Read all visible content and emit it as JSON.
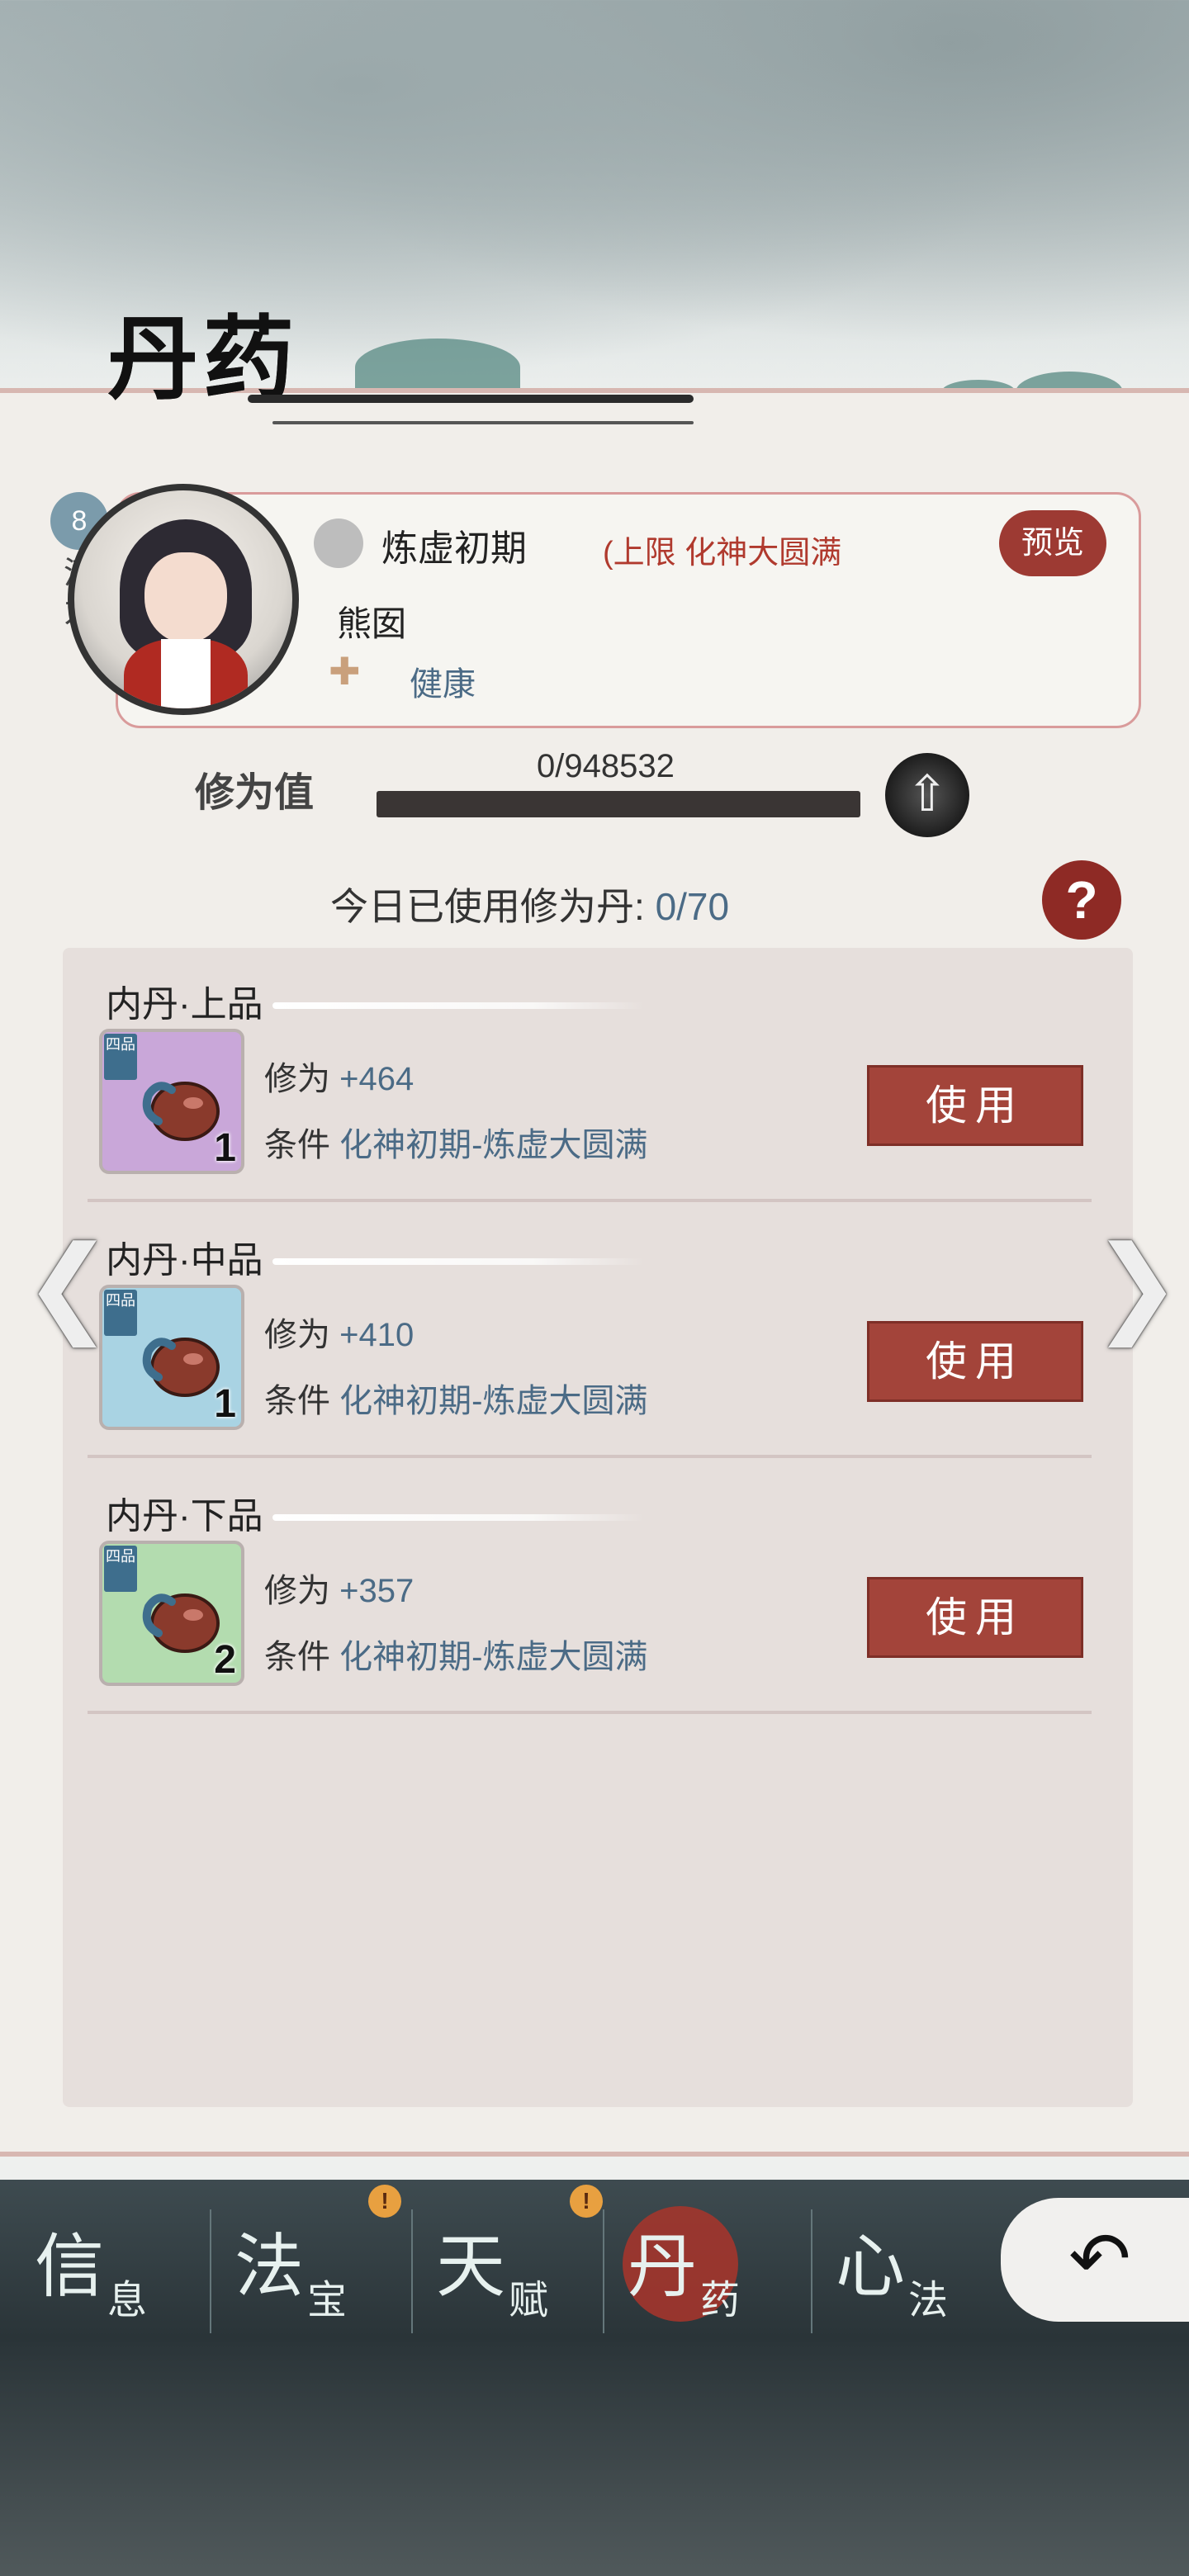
{
  "screen": {
    "title": "丹药"
  },
  "character": {
    "potential_value": "8",
    "potential_label": "潜力",
    "realm": "炼虚初期",
    "limit": "(上限 化神大圆满",
    "preview_label": "预览",
    "name": "熊囡",
    "health": "健康"
  },
  "cultivation": {
    "label": "修为值",
    "value_text": "0/948532",
    "progress": 0
  },
  "daily": {
    "label": "今日已使用修为丹:",
    "value": "0/70",
    "help_label": "?"
  },
  "pills": [
    {
      "title": "内丹·上品",
      "tag": "四品",
      "count": "1",
      "stat_label": "修为",
      "stat_value": "+464",
      "cond_label": "条件",
      "cond_value": "化神初期-炼虚大圆满",
      "button": "使用",
      "color": "#c9a7d9"
    },
    {
      "title": "内丹·中品",
      "tag": "四品",
      "count": "1",
      "stat_label": "修为",
      "stat_value": "+410",
      "cond_label": "条件",
      "cond_value": "化神初期-炼虚大圆满",
      "button": "使用",
      "color": "#a9d3e3"
    },
    {
      "title": "内丹·下品",
      "tag": "四品",
      "count": "2",
      "stat_label": "修为",
      "stat_value": "+357",
      "cond_label": "条件",
      "cond_value": "化神初期-炼虚大圆满",
      "button": "使用",
      "color": "#b3dcaf"
    }
  ],
  "nav": {
    "tabs": [
      {
        "big": "信",
        "small": "息"
      },
      {
        "big": "法",
        "small": "宝",
        "alert": "!"
      },
      {
        "big": "天",
        "small": "赋",
        "alert": "!"
      },
      {
        "big": "丹",
        "small": "药",
        "active": true
      },
      {
        "big": "心",
        "small": "法"
      }
    ],
    "back_icon": "back-arrow-icon"
  },
  "colors": {
    "accent": "#a3443a",
    "link": "#4b6b86"
  }
}
